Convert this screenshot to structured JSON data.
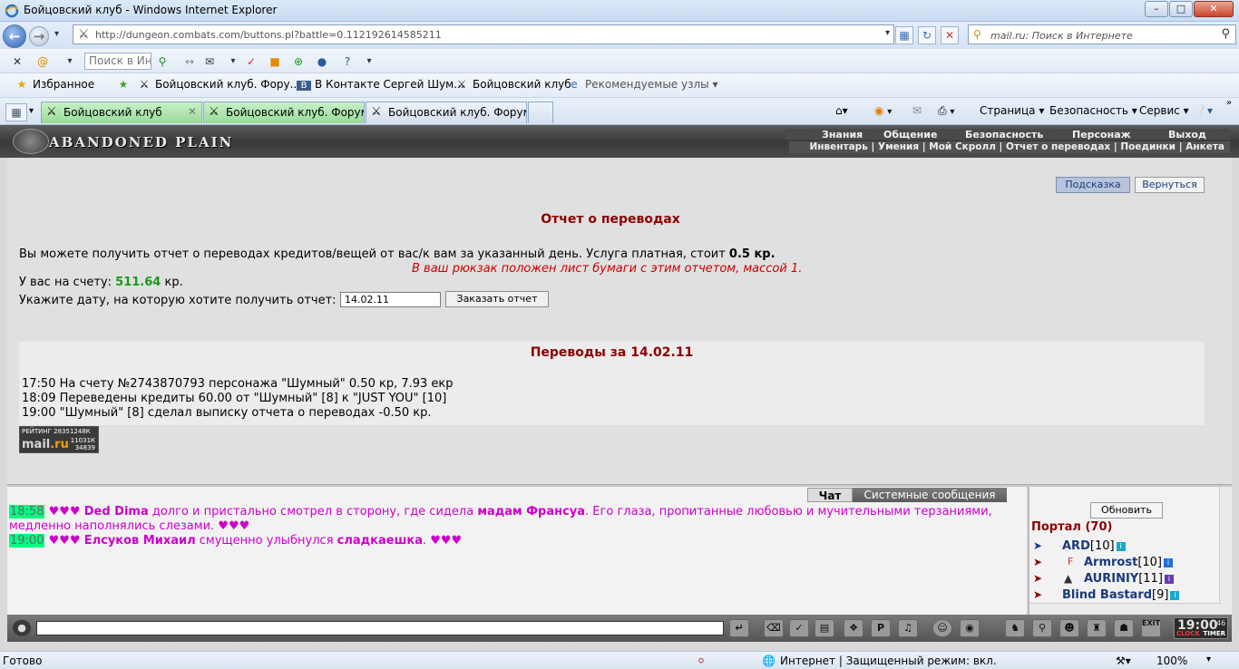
{
  "window": {
    "title": "Бойцовский клуб - Windows Internet Explorer",
    "minimize": "–",
    "maximize": "□",
    "close": "✕"
  },
  "address_bar": {
    "url": "http://dungeon.combats.com/buttons.pl?battle=0.112192614585211",
    "search_placeholder": "mail.ru: Поиск в Интернете"
  },
  "toolbar": {
    "search_value": "Поиск в Инте"
  },
  "favorites": {
    "favorites_label": "Избранное",
    "items": [
      {
        "label": "Бойцовский клуб. Фору..."
      },
      {
        "label": "В Контакте  Сергей Шум..."
      },
      {
        "label": "Бойцовский клуб"
      },
      {
        "label": "Рекомендуемые узлы ▾"
      }
    ]
  },
  "tabs": [
    {
      "label": "Бойцовский клуб"
    },
    {
      "label": "Бойцовский клуб. Форум..."
    },
    {
      "label": "Бойцовский клуб. Форум..."
    }
  ],
  "command_bar": {
    "page": "Страница ▾",
    "safety": "Безопасность ▾",
    "tools": "Сервис ▾"
  },
  "game": {
    "logo_text": "ABANDONED PLAIN",
    "top_menu": [
      "Знания",
      "Общение",
      "Безопасность",
      "Персонаж",
      "Выход"
    ],
    "sub_menu": "Инвентарь | Умения | Мой Скролл | Отчет о переводах | Поединки | Анкета",
    "buttons": {
      "hint": "Подсказка",
      "back": "Вернуться"
    },
    "report": {
      "title": "Отчет о переводах",
      "info_text": "Вы можете получить отчет о переводах кредитов/вещей от вас/к вам за указанный день. Услуга платная, стоит ",
      "info_price": "0.5 кр.",
      "notice": "В ваш рюкзак положен лист бумаги с этим отчетом, массой 1.",
      "balance_label": "У вас на счету: ",
      "balance_value": "511.64",
      "balance_unit": " кр.",
      "date_label": "Укажите дату, на которую хотите получить отчет:",
      "date_value": "14.02.11",
      "order_button": "Заказать отчет"
    },
    "transfers": {
      "title": "Переводы за 14.02.11",
      "lines": [
        "17:50 На счету №2743870793 персонажа \"Шумный\" 0.50 кр, 7.93 екр",
        "18:09 Переведены кредиты 60.00 от \"Шумный\" [8] к \"JUST YOU\" [10]",
        "19:00 \"Шумный\" [8] сделал выписку отчета о переводах -0.50 кр."
      ]
    },
    "rating": {
      "label": "РЕЙТИНГ 28351248К",
      "brand_a": "mail",
      "brand_b": ".ru",
      "stats_1": "11031К",
      "stats_2": "34839"
    },
    "chat": {
      "tab_chat": "Чат",
      "tab_system": "Системные сообщения",
      "messages": [
        {
          "time": "18:58",
          "hearts": "♥♥♥",
          "nick": "Ded Dima",
          "text1": " долго и пристально смотрел в сторону, где сидела ",
          "target": "мадам Франсуа",
          "text2": ". Его глаза, пропитанные любовью и мучительными терзаниями, медленно наполнялись слезами. ",
          "hearts_end": "♥♥♥"
        },
        {
          "time": "19:00",
          "hearts": "♥♥♥",
          "nick": "Елсуков Михаил",
          "text1": " смущенно улыбнулся ",
          "target": "сладкаешка",
          "text2": ". ",
          "hearts_end": "♥♥♥"
        }
      ]
    },
    "side": {
      "refresh": "Обновить",
      "portal": "Портал (70)",
      "users": [
        {
          "name": "ARD",
          "level": "[10]"
        },
        {
          "name": "Armrost",
          "level": "[10]"
        },
        {
          "name": "AURINIY",
          "level": "[11]"
        },
        {
          "name": "Blind Bastard",
          "level": "[9]"
        }
      ]
    },
    "clock": {
      "time": "19:00",
      "seconds": "46",
      "clock_label": "CLOCK",
      "timer_label": "TIMER",
      "exit": "EXIT"
    }
  },
  "status_bar": {
    "status": "Готово",
    "zone": "Интернет | Защищенный режим: вкл.",
    "zoom": "100%"
  }
}
